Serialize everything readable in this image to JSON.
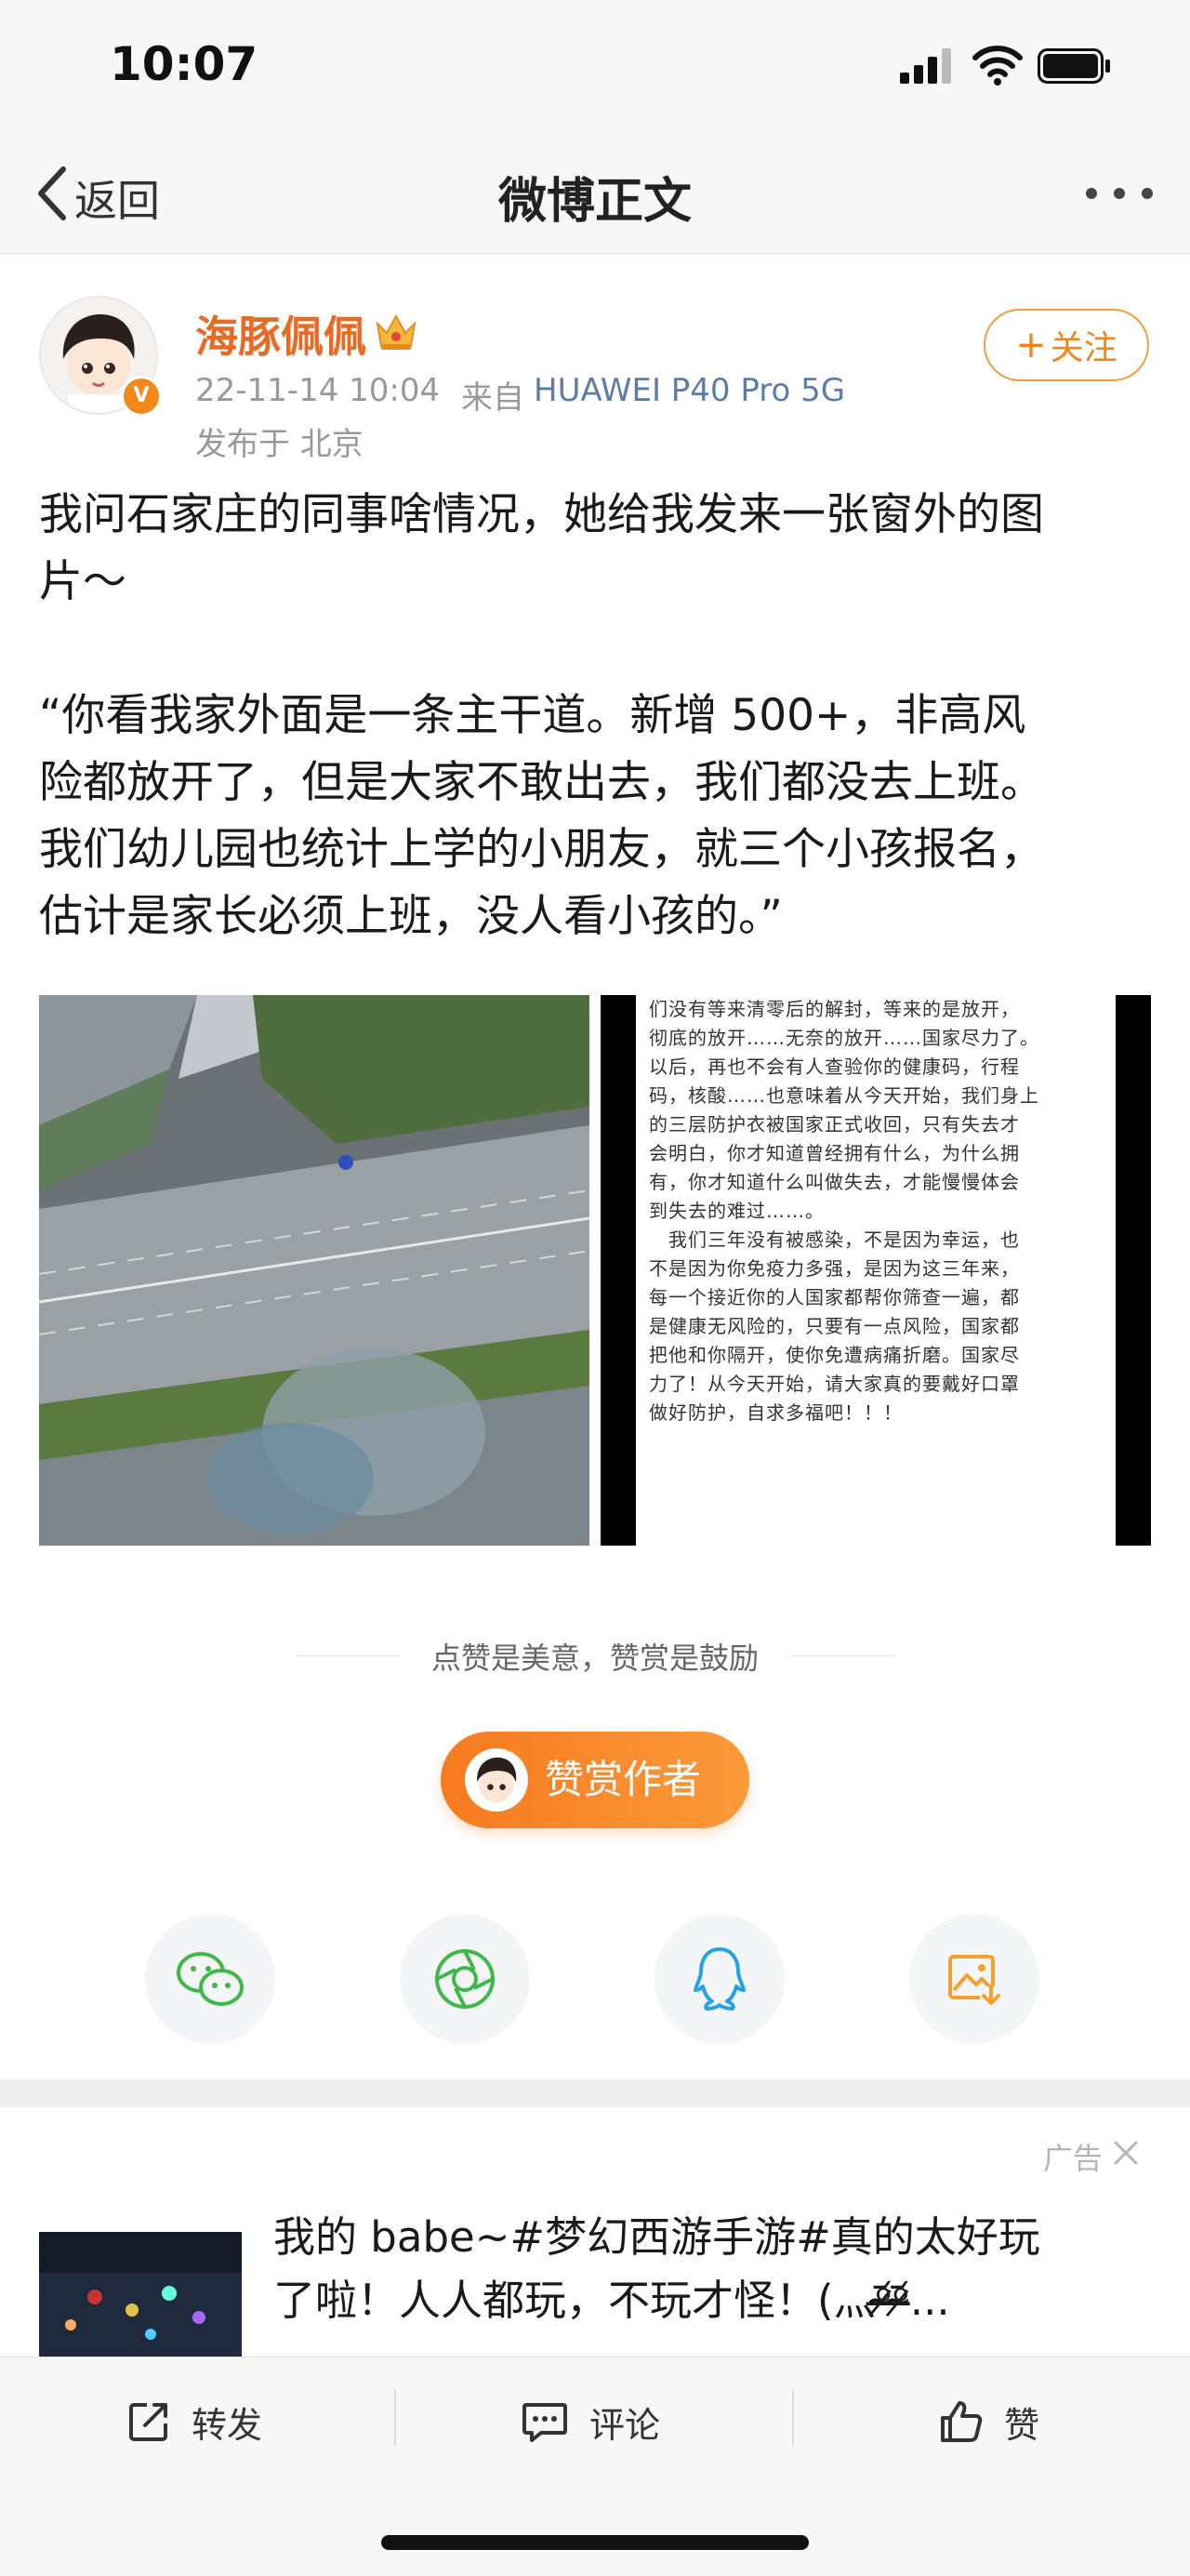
{
  "status_bar": {
    "time": "10:07"
  },
  "nav": {
    "back_label": "返回",
    "title": "微博正文"
  },
  "author": {
    "name": "海豚佩佩",
    "verified_badge": "V",
    "time": "22-11-14 10:04",
    "from_label": "来自",
    "device": "HUAWEI P40 Pro 5G",
    "location": "发布于 北京",
    "follow_label": "关注"
  },
  "post": {
    "text_lines": [
      "我问石家庄的同事啥情况，她给我发来一张窗外的图",
      "片～",
      "“你看我家外面是一条主干道。新增 500+，非高风",
      "险都放开了，但是大家不敢出去，我们都没去上班。",
      "我们幼儿园也统计上学的小朋友，就三个小孩报名，",
      "估计是家长必须上班，没人看小孩的。”"
    ],
    "image2_lines": [
      "们没有等来清零后的解封，等来的是放开，",
      "彻底的放开……无奈的放开……国家尽力了。",
      "以后，再也不会有人查验你的健康码，行程",
      "码，核酸……也意味着从今天开始，我们身上",
      "的三层防护衣被国家正式收回，只有失去才",
      "会明白，你才知道曾经拥有什么，为什么拥",
      "有，你才知道什么叫做失去，才能慢慢体会",
      "到失去的难过……。",
      "　我们三年没有被感染，不是因为幸运，也",
      "不是因为你免疫力多强，是因为这三年来，",
      "每一个接近你的人国家都帮你筛查一遍，都",
      "是健康无风险的，只要有一点风险，国家都",
      "把他和你隔开，使你免遭病痛折磨。国家尽",
      "力了！从今天开始，请大家真的要戴好口罩",
      "做好防护，自求多福吧！！！"
    ]
  },
  "reward": {
    "tip": "点赞是美意，赞赏是鼓励",
    "button_label": "赞赏作者"
  },
  "share": {
    "items": [
      {
        "icon": "wechat-icon",
        "color": "#3fb84b"
      },
      {
        "icon": "moments-icon",
        "color": "#3fb84b"
      },
      {
        "icon": "qq-icon",
        "color": "#27a1e6"
      },
      {
        "icon": "save-image-icon",
        "color": "#f3a12d"
      }
    ]
  },
  "ad": {
    "label": "广告",
    "text_lines": [
      "我的 babe~#梦幻西游手游#真的太好玩",
      "了啦！人人都玩，不玩才怪！(灬ᵒ̴̶̷᷄ᵒ̴̶̷᷄..."
    ]
  },
  "bottom_bar": {
    "repost_label": "转发",
    "comment_label": "评论",
    "like_label": "赞"
  },
  "colors": {
    "accent_orange": "#f08621",
    "author_name": "#e86a24",
    "link_blue": "#5d7da6"
  }
}
